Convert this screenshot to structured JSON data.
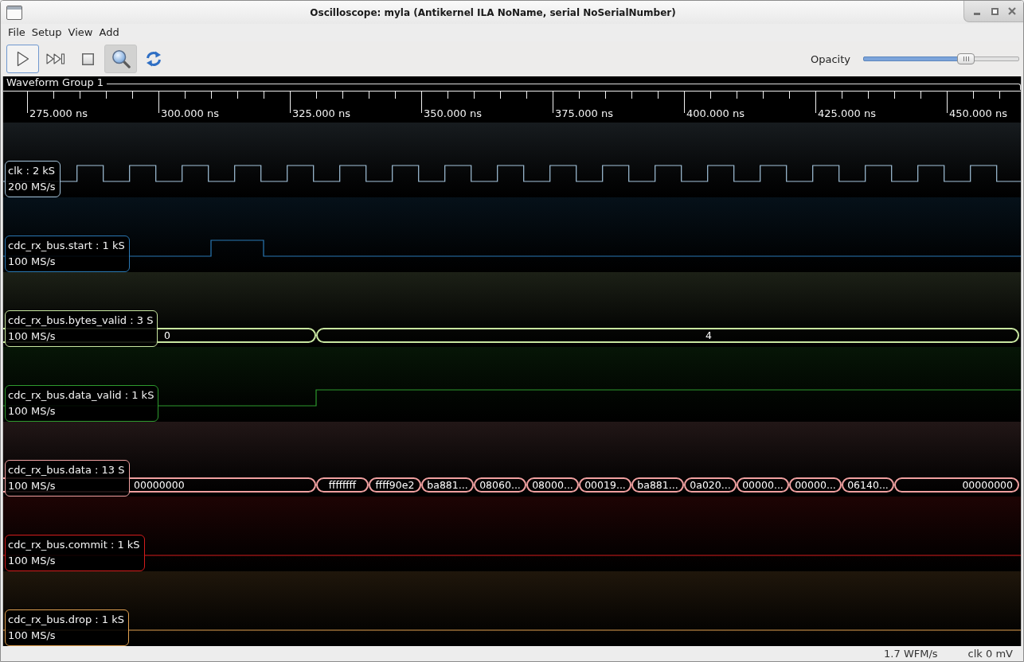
{
  "window": {
    "title": "Oscilloscope: myla (Antikernel ILA NoName, serial NoSerialNumber)"
  },
  "menu": [
    {
      "label": "File"
    },
    {
      "label": "Setup"
    },
    {
      "label": "View"
    },
    {
      "label": "Add"
    }
  ],
  "toolbar": {
    "buttons": [
      {
        "kind": "run",
        "focused": true,
        "pressed": false
      },
      {
        "kind": "single",
        "focused": false,
        "pressed": false
      },
      {
        "kind": "stop",
        "focused": false,
        "pressed": false
      },
      {
        "kind": "zoom",
        "focused": false,
        "pressed": true
      },
      {
        "kind": "refresh",
        "focused": false,
        "pressed": false
      }
    ],
    "opacity": {
      "label": "Opacity",
      "level": 0.66
    }
  },
  "waveform_group": {
    "title": "Waveform Group 1",
    "ticks": [
      "275.000 ns",
      "300.000 ns",
      "325.000 ns",
      "350.000 ns",
      "375.000 ns",
      "400.000 ns",
      "425.000 ns",
      "450.000 ns"
    ],
    "channels": [
      {
        "kind": "digital",
        "name": "clk : 2 kS",
        "rate": "200 MS/s",
        "color": "#a4c4dc"
      },
      {
        "kind": "digital",
        "name": "cdc_rx_bus.start : 1 kS",
        "rate": "100 MS/s",
        "color": "#2a78b4"
      },
      {
        "kind": "bus",
        "name": "cdc_rx_bus.bytes_valid : 3 S",
        "rate": "100 MS/s",
        "color": "#c8e6a0",
        "values": [
          "0",
          "4"
        ]
      },
      {
        "kind": "digital",
        "name": "cdc_rx_bus.data_valid : 1 kS",
        "rate": "100 MS/s",
        "color": "#2e9a2e"
      },
      {
        "kind": "bus",
        "name": "cdc_rx_bus.data : 13 S",
        "rate": "100 MS/s",
        "color": "#f0a0a0",
        "values": [
          "00000000",
          "ffffffff",
          "ffff90e2",
          "ba881...",
          "08060...",
          "08000...",
          "00019...",
          "ba881...",
          "0a020...",
          "00000...",
          "00000...",
          "06140...",
          "00000000"
        ]
      },
      {
        "kind": "digital",
        "name": "cdc_rx_bus.commit : 1 kS",
        "rate": "100 MS/s",
        "color": "#d41c1c"
      },
      {
        "kind": "digital",
        "name": "cdc_rx_bus.drop : 1 kS",
        "rate": "100 MS/s",
        "color": "#e0a050"
      }
    ]
  },
  "status_bar": [
    "1.7 WFM/s",
    "clk 0 mV"
  ]
}
